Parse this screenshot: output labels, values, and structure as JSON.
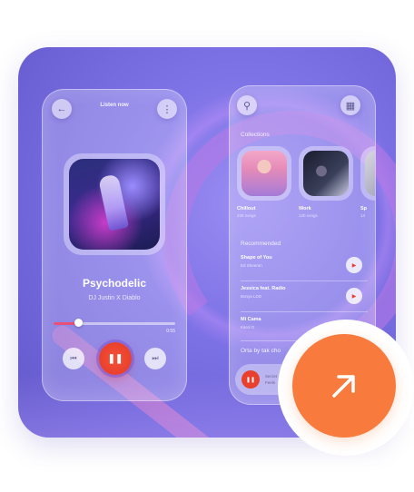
{
  "player": {
    "header_title": "Listen now",
    "song_title": "Psychodelic",
    "artist": "DJ Justin X Diablo",
    "time_elapsed": "",
    "time_total": "0:55",
    "progress": 0.2
  },
  "library": {
    "collections_label": "Collections",
    "collections": [
      {
        "name": "Chillout",
        "count": "236 songs"
      },
      {
        "name": "Work",
        "count": "120 songs"
      },
      {
        "name": "Sp",
        "count": "14"
      }
    ],
    "recommended_label": "Recommended",
    "recommended": [
      {
        "title": "Shape of You",
        "artist": "Ed Sheeran"
      },
      {
        "title": "Jessica feat. Radio",
        "artist": "Bonya LDD"
      },
      {
        "title": "Mi Cama",
        "artist": "Karol G"
      }
    ],
    "tag_section_label": "Orta by tak cho",
    "mini_line1": "Secret",
    "mini_line2": "Feels"
  },
  "colors": {
    "accent_red": "#e8402c",
    "cta_orange": "#f87a3c",
    "background_purple": "#7d72e6"
  },
  "icons": {
    "back": "arrow-left-icon",
    "menu": "more-vertical-icon",
    "search": "search-icon",
    "grid": "grid-icon",
    "cta": "arrow-up-right-icon"
  }
}
